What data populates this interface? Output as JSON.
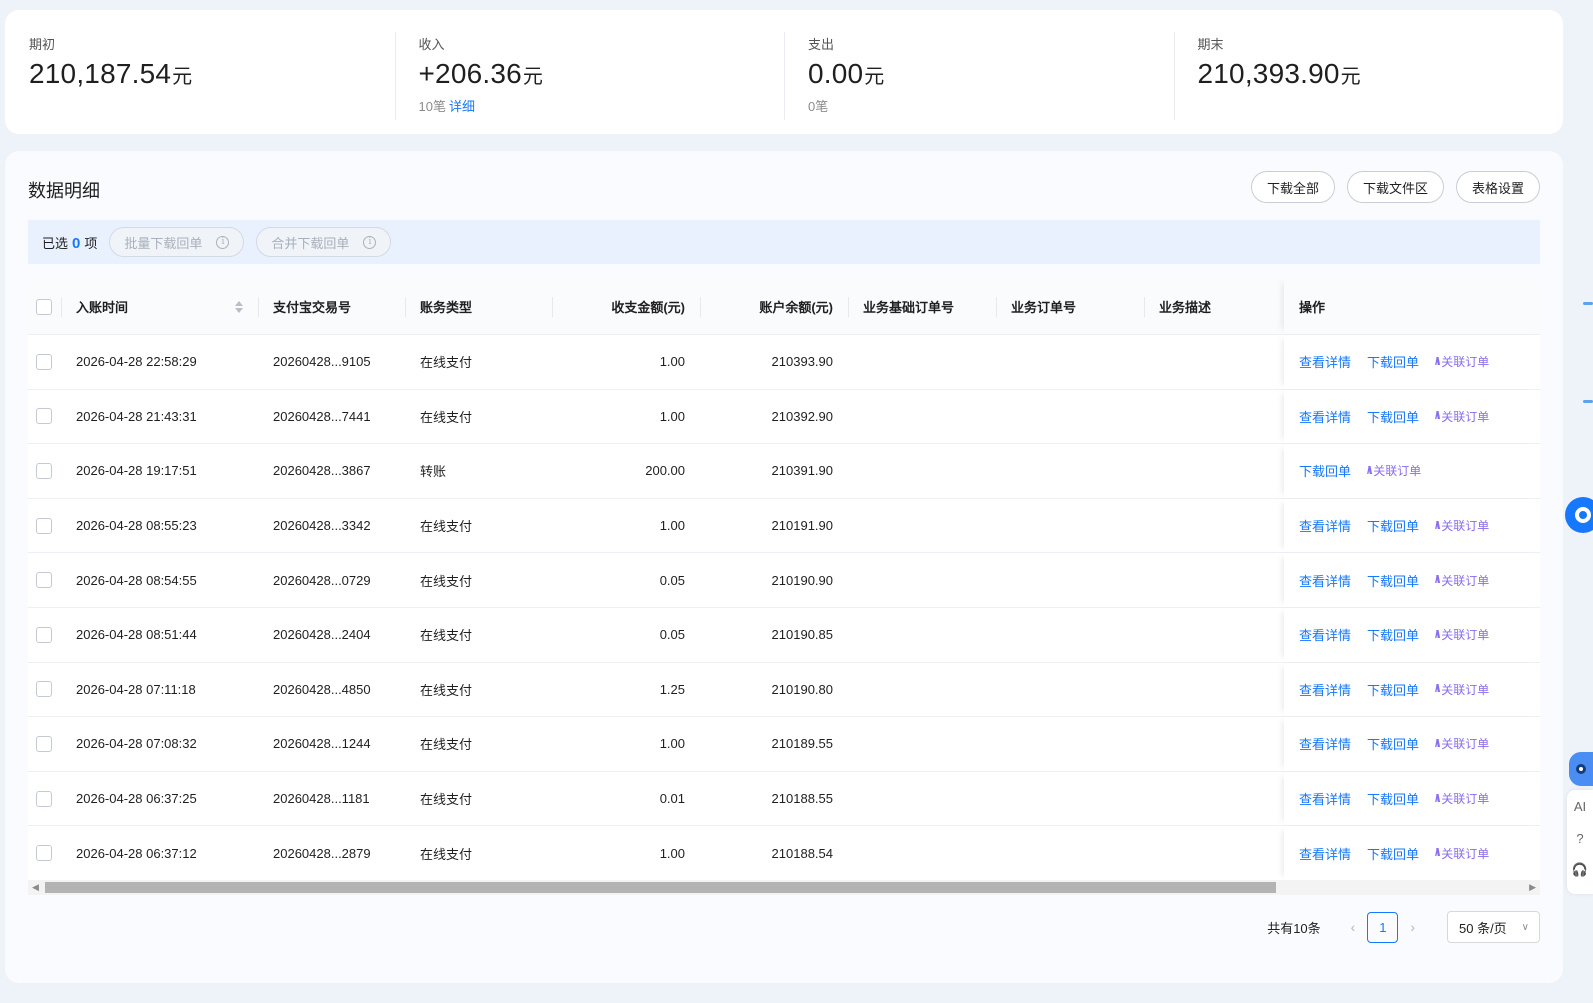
{
  "summary": [
    {
      "label": "期初",
      "amount": "210,187.54",
      "unit": "元",
      "sub_count": "",
      "sub_link": ""
    },
    {
      "label": "收入",
      "amount": "+206.36",
      "unit": "元",
      "sub_count": "10笔",
      "sub_link": "详细"
    },
    {
      "label": "支出",
      "amount": "0.00",
      "unit": "元",
      "sub_count": "0笔",
      "sub_link": ""
    },
    {
      "label": "期末",
      "amount": "210,393.90",
      "unit": "元",
      "sub_count": "",
      "sub_link": ""
    }
  ],
  "section": {
    "title": "数据明细",
    "buttons": [
      "下载全部",
      "下载文件区",
      "表格设置"
    ]
  },
  "selection": {
    "prefix": "已选",
    "count": "0",
    "suffix": "项",
    "batch_download": "批量下载回单",
    "merge_download": "合并下载回单",
    "info_glyph": "i"
  },
  "table": {
    "headers": [
      "入账时间",
      "支付宝交易号",
      "账务类型",
      "收支金额(元)",
      "账户余额(元)",
      "业务基础订单号",
      "业务订单号",
      "业务描述",
      "操作"
    ],
    "rows": [
      {
        "time": "2026-04-28 22:58:29",
        "tid": "20260428...9105",
        "type": "在线支付",
        "amount": "1.00",
        "balance": "210393.90",
        "ops": [
          "查看详情",
          "下载回单"
        ],
        "ai": "关联订单"
      },
      {
        "time": "2026-04-28 21:43:31",
        "tid": "20260428...7441",
        "type": "在线支付",
        "amount": "1.00",
        "balance": "210392.90",
        "ops": [
          "查看详情",
          "下载回单"
        ],
        "ai": "关联订单"
      },
      {
        "time": "2026-04-28 19:17:51",
        "tid": "20260428...3867",
        "type": "转账",
        "amount": "200.00",
        "balance": "210391.90",
        "ops": [
          "下载回单"
        ],
        "ai": "关联订单"
      },
      {
        "time": "2026-04-28 08:55:23",
        "tid": "20260428...3342",
        "type": "在线支付",
        "amount": "1.00",
        "balance": "210191.90",
        "ops": [
          "查看详情",
          "下载回单"
        ],
        "ai": "关联订单"
      },
      {
        "time": "2026-04-28 08:54:55",
        "tid": "20260428...0729",
        "type": "在线支付",
        "amount": "0.05",
        "balance": "210190.90",
        "ops": [
          "查看详情",
          "下载回单"
        ],
        "ai": "关联订单"
      },
      {
        "time": "2026-04-28 08:51:44",
        "tid": "20260428...2404",
        "type": "在线支付",
        "amount": "0.05",
        "balance": "210190.85",
        "ops": [
          "查看详情",
          "下载回单"
        ],
        "ai": "关联订单"
      },
      {
        "time": "2026-04-28 07:11:18",
        "tid": "20260428...4850",
        "type": "在线支付",
        "amount": "1.25",
        "balance": "210190.80",
        "ops": [
          "查看详情",
          "下载回单"
        ],
        "ai": "关联订单"
      },
      {
        "time": "2026-04-28 07:08:32",
        "tid": "20260428...1244",
        "type": "在线支付",
        "amount": "1.00",
        "balance": "210189.55",
        "ops": [
          "查看详情",
          "下载回单"
        ],
        "ai": "关联订单"
      },
      {
        "time": "2026-04-28 06:37:25",
        "tid": "20260428...1181",
        "type": "在线支付",
        "amount": "0.01",
        "balance": "210188.55",
        "ops": [
          "查看详情",
          "下载回单"
        ],
        "ai": "关联订单"
      },
      {
        "time": "2026-04-28 06:37:12",
        "tid": "20260428...2879",
        "type": "在线支付",
        "amount": "1.00",
        "balance": "210188.54",
        "ops": [
          "查看详情",
          "下载回单"
        ],
        "ai": "关联订单"
      }
    ]
  },
  "pagination": {
    "total": "共有10条",
    "current_page": "1",
    "page_size": "50 条/页"
  },
  "side_tools": [
    "AI",
    "?",
    "🎧"
  ],
  "colors": {
    "accent": "#1677ff",
    "ai": "#8a6cf0",
    "selbar_bg": "#e8f1fd"
  },
  "icons": [
    "info-icon",
    "sort-icon",
    "checkbox-icon",
    "chevron-left-icon",
    "chevron-right-icon",
    "chevron-down-icon",
    "ai-sparkle-icon",
    "assistant-bot-icon",
    "help-icon",
    "headset-icon"
  ]
}
